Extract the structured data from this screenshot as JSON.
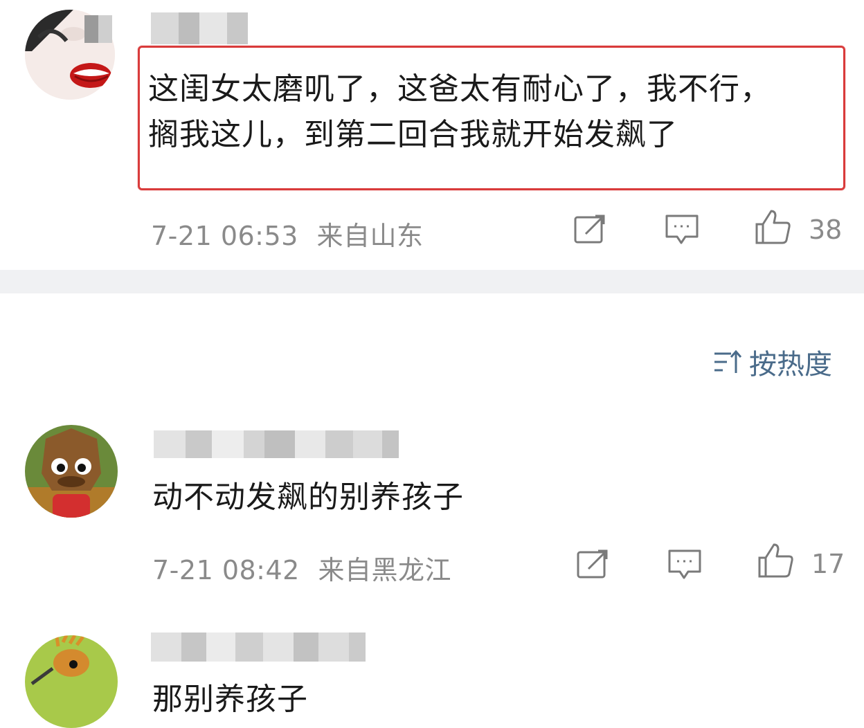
{
  "comments": [
    {
      "text_lines": [
        "这闺女太磨叽了，这爸太有耐心了，我不行，",
        "搁我这儿，到第二回合我就开始发飙了"
      ],
      "timestamp": "7-21 06:53",
      "location": "来自山东",
      "likes": "38",
      "highlighted": true
    },
    {
      "text": "动不动发飙的别养孩子",
      "timestamp": "7-21 08:42",
      "location": "来自黑龙江",
      "likes": "17"
    },
    {
      "text": "那别养孩子"
    }
  ],
  "sort": {
    "label": "按热度",
    "icon": "sort-icon"
  },
  "icons": {
    "share": "share-icon",
    "comment": "comment-icon",
    "like": "thumbs-up-icon"
  },
  "colors": {
    "highlight": "#d93b3b",
    "meta": "#8a8a8a",
    "sort": "#4a6b8a",
    "divider": "#f0f1f3"
  }
}
